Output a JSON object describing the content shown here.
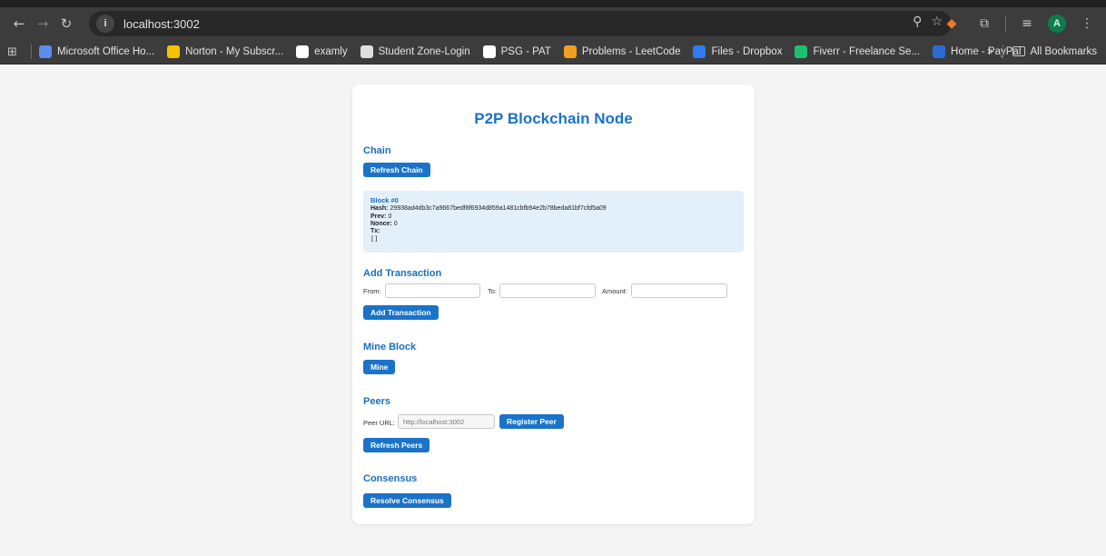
{
  "browser": {
    "url": "localhost:3002",
    "bookmarks": [
      {
        "label": "Microsoft Office Ho...",
        "color": "#5b8def"
      },
      {
        "label": "Norton - My Subscr...",
        "color": "#f5c400"
      },
      {
        "label": "examly",
        "color": "#ffffff"
      },
      {
        "label": "Student Zone-Login",
        "color": "#e0e0e0"
      },
      {
        "label": "PSG - PAT",
        "color": "#ffffff"
      },
      {
        "label": "Problems - LeetCode",
        "color": "#f0a020"
      },
      {
        "label": "Files - Dropbox",
        "color": "#2f7bf5"
      },
      {
        "label": "Fiverr - Freelance Se...",
        "color": "#1dbf73"
      },
      {
        "label": "Home - PayPal",
        "color": "#2a6cd6"
      }
    ],
    "more_label": "»",
    "all_bookmarks": "All Bookmarks",
    "avatar_letter": "A"
  },
  "page": {
    "title": "P2P Blockchain Node",
    "chain": {
      "heading": "Chain",
      "refresh_label": "Refresh Chain",
      "block": {
        "title": "Block #0",
        "hash_label": "Hash:",
        "hash": "29938ad4db3c7a9667bedf8f6934d859a1481cbfb94e2b78beda81bf7cfd5a09",
        "prev_label": "Prev:",
        "prev": "0",
        "nonce_label": "Nonce:",
        "nonce": "0",
        "tx_label": "Tx:",
        "tx": "[]"
      }
    },
    "transaction": {
      "heading": "Add Transaction",
      "from_label": "From:",
      "to_label": "To:",
      "amount_label": "Amount:",
      "from_value": "",
      "to_value": "",
      "amount_value": "",
      "button": "Add Transaction"
    },
    "mine": {
      "heading": "Mine Block",
      "button": "Mine"
    },
    "peers": {
      "heading": "Peers",
      "url_label": "Peer URL:",
      "url_placeholder": "http://localhost:3002",
      "register_button": "Register Peer",
      "refresh_button": "Refresh Peers"
    },
    "consensus": {
      "heading": "Consensus",
      "button": "Resolve Consensus"
    }
  }
}
